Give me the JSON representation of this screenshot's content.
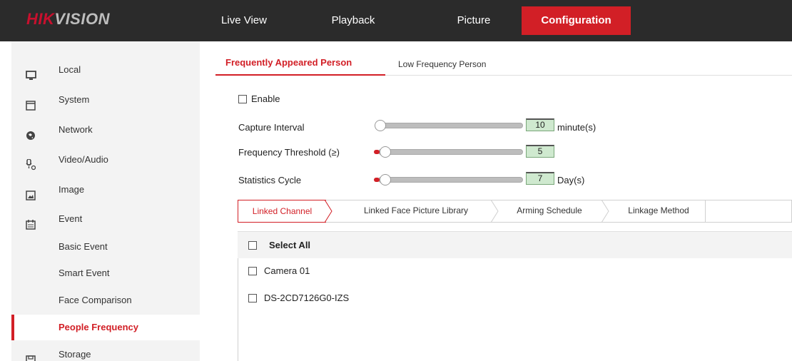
{
  "logo": {
    "part1": "HIK",
    "part2": "VISION"
  },
  "nav": {
    "tabs": [
      {
        "label": "Live View"
      },
      {
        "label": "Playback"
      },
      {
        "label": "Picture"
      },
      {
        "label": "Configuration"
      }
    ],
    "active": "Configuration"
  },
  "sidebar": {
    "items": [
      {
        "label": "Local",
        "icon": "monitor-icon"
      },
      {
        "label": "System",
        "icon": "system-window-icon"
      },
      {
        "label": "Network",
        "icon": "globe-icon"
      },
      {
        "label": "Video/Audio",
        "icon": "microphone-icon"
      },
      {
        "label": "Image",
        "icon": "image-icon"
      },
      {
        "label": "Event",
        "icon": "calendar-icon"
      },
      {
        "label": "Basic Event"
      },
      {
        "label": "Smart Event"
      },
      {
        "label": "Face Comparison"
      },
      {
        "label": "People Frequency"
      },
      {
        "label": "Storage",
        "icon": "floppy-disk-icon"
      }
    ],
    "active": "People Frequency"
  },
  "subtabs": [
    {
      "label": "Frequently Appeared Person"
    },
    {
      "label": "Low Frequency Person"
    }
  ],
  "form": {
    "enable_label": "Enable",
    "enable_checked": false,
    "capture_interval": {
      "label": "Capture Interval",
      "value": "10",
      "unit": "minute(s)"
    },
    "frequency_threshold": {
      "label": "Frequency Threshold (≥)",
      "value": "5"
    },
    "statistics_cycle": {
      "label": "Statistics Cycle",
      "value": "7",
      "unit": "Day(s)"
    }
  },
  "linked_tabs": [
    {
      "label": "Linked Channel"
    },
    {
      "label": "Linked Face Picture Library"
    },
    {
      "label": "Arming Schedule"
    },
    {
      "label": "Linkage Method"
    }
  ],
  "channels": {
    "select_all": "Select All",
    "items": [
      {
        "label": "Camera 01",
        "checked": false
      },
      {
        "label": "DS-2CD7126G0-IZS",
        "checked": false
      }
    ]
  },
  "colors": {
    "accent": "#d21f26",
    "topbar": "#2b2b2b",
    "sidebar": "#f3f3f3",
    "value_box": "#cfe9cf"
  }
}
